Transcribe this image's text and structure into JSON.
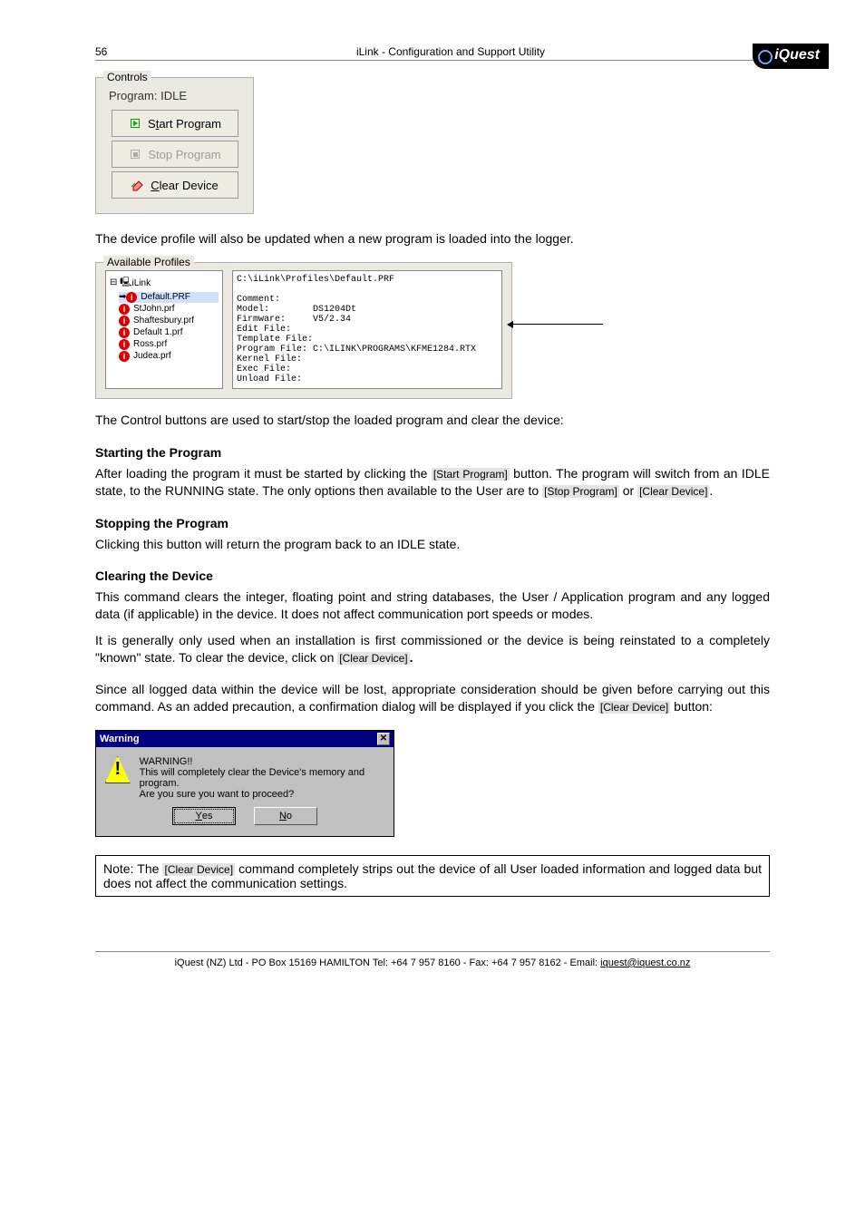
{
  "header": {
    "page_number": "56",
    "title": "iLink - Configuration and Support Utility",
    "logo_text": "iQuest"
  },
  "controls": {
    "legend": "Controls",
    "status_label": "Program:",
    "status_value": "IDLE",
    "start_label": "Start Program",
    "stop_label": "Stop Program",
    "clear_label": "Clear Device"
  },
  "para_profile_update": "The device profile will also be updated when a new program is loaded into the logger.",
  "profiles": {
    "legend": "Available Profiles",
    "tree_root": "iLink",
    "items": [
      "Default.PRF",
      "StJohn.prf",
      "Shaftesbury.prf",
      "Default 1.prf",
      "Ross.prf",
      "Judea.prf"
    ],
    "info": "C:\\iLink\\Profiles\\Default.PRF\n\nComment:\nModel:        DS1204Dt\nFirmware:     V5/2.34\nEdit File:\nTemplate File:\nProgram File: C:\\ILINK\\PROGRAMS\\KFME1284.RTX\nKernel File:\nExec File:\nUnload File:"
  },
  "para_controls_intro": "The Control buttons are used to start/stop the loaded program and clear the device:",
  "sections": {
    "start_heading": "Starting the Program",
    "start_text_a": "After loading the program it must be started by clicking the ",
    "start_btn": "[Start Program]",
    "start_text_b": " button.  The program will switch from an IDLE state, to the RUNNING state.  The only options then available to the User are to ",
    "stop_btn": "[Stop Program]",
    "start_text_c": " or ",
    "clear_btn": "[Clear Device]",
    "start_text_d": ".",
    "stop_heading": "Stopping the Program",
    "stop_text": "Clicking this button will return the program back to an IDLE state.",
    "clear_heading": "Clearing the Device",
    "clear_text1": "This command clears the integer, floating point and string databases, the User / Application program and any logged data (if applicable) in the device.  It does not affect communication port speeds or modes.",
    "clear_text2_a": "It is generally only used when an installation is first commissioned or the device is being reinstated to a completely \"known\" state.  To clear the device, click on ",
    "clear_text2_b": ".",
    "clear_text3_a": "Since all logged data within the device will be lost, appropriate consideration should be given before carrying out this command.  As an added precaution, a confirmation dialog will be displayed if you click the ",
    "clear_text3_b": " button:"
  },
  "warning": {
    "title": "Warning",
    "line1": "WARNING!!",
    "line2": "This will completely clear the Device's memory and program.",
    "line3": "Are you sure you want to proceed?",
    "yes": "Yes",
    "no": "No"
  },
  "note": {
    "prefix": "Note: The ",
    "btn": "[Clear Device]",
    "rest": " command completely strips out the device of all User loaded information and logged data but does not affect the communication settings."
  },
  "footer": {
    "text_a": "iQuest (NZ) Ltd  - PO Box 15169 HAMILTON  Tel: +64 7 957 8160 - Fax: +64 7 957 8162 - Email: ",
    "email": "iquest@iquest.co.nz"
  }
}
